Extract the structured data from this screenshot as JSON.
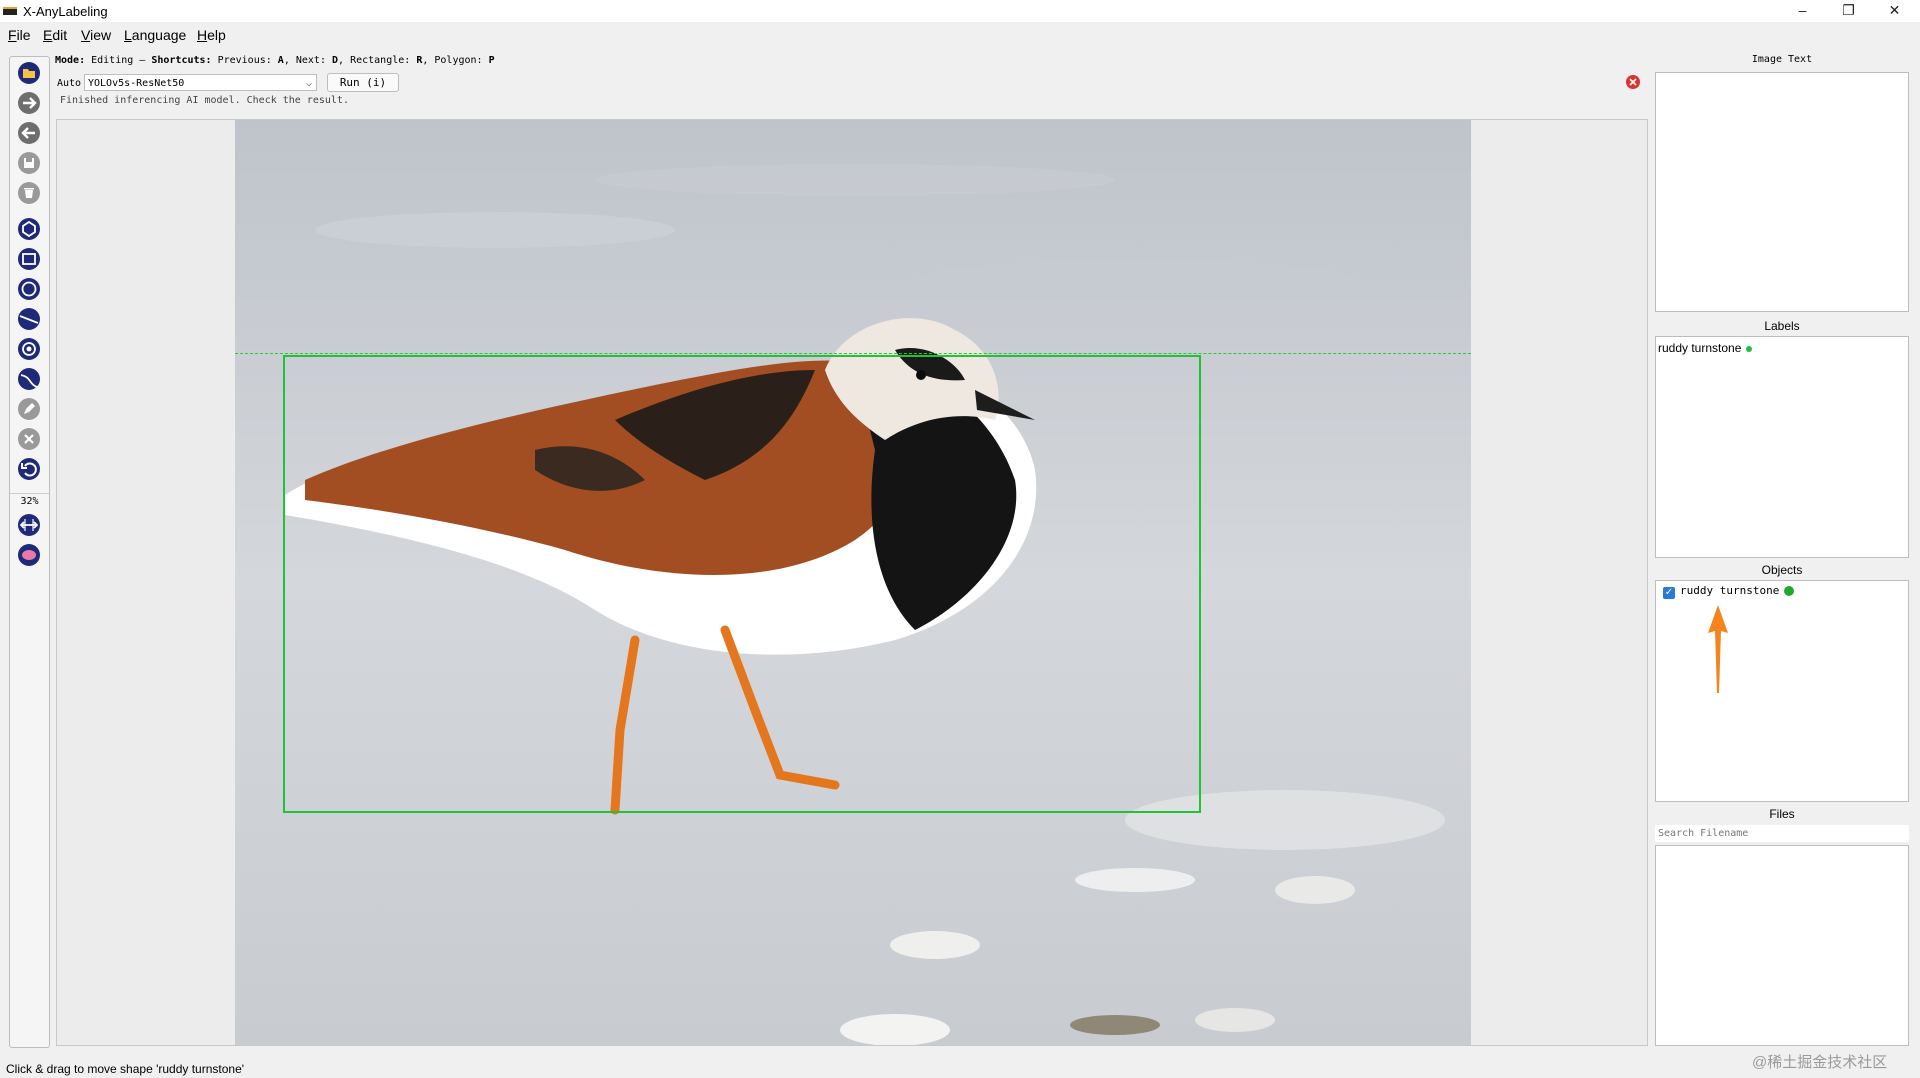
{
  "window": {
    "title": "X-AnyLabeling",
    "minimize": "–",
    "restore": "❐",
    "close": "✕"
  },
  "menu": [
    "File",
    "Edit",
    "View",
    "Language",
    "Help"
  ],
  "toolbar": {
    "zoom": "32%"
  },
  "mode": {
    "prefix": "Mode: ",
    "mode": "Editing",
    "sep": " – ",
    "shortcuts_label": "Shortcuts: ",
    "prev_label": "Previous: ",
    "prev_key": "A",
    "next_label": ", Next: ",
    "next_key": "D",
    "rect_label": ", Rectangle: ",
    "rect_key": "R",
    "poly_label": ", Polygon: ",
    "poly_key": "P"
  },
  "auto": {
    "label": "Auto",
    "model": "YOLOv5s-ResNet50",
    "run_button": "Run (i)",
    "status": "Finished inferencing AI model. Check the result."
  },
  "panels": {
    "image_text": "Image Text",
    "labels": {
      "title": "Labels",
      "items": [
        {
          "text": "ruddy turnstone",
          "color": "#22c03a"
        }
      ]
    },
    "objects": {
      "title": "Objects",
      "items": [
        {
          "text": "ruddy turnstone",
          "checked": true,
          "color": "#1fa830"
        }
      ]
    },
    "files": {
      "title": "Files",
      "search_placeholder": "Search Filename"
    }
  },
  "statusbar": "Click & drag to move shape 'ruddy turnstone'",
  "watermark": "@稀土掘金技术社区",
  "colors": {
    "bbox": "#25c03a",
    "accent_arrow": "#f5841f",
    "tool_icon": "#1e2a78"
  }
}
